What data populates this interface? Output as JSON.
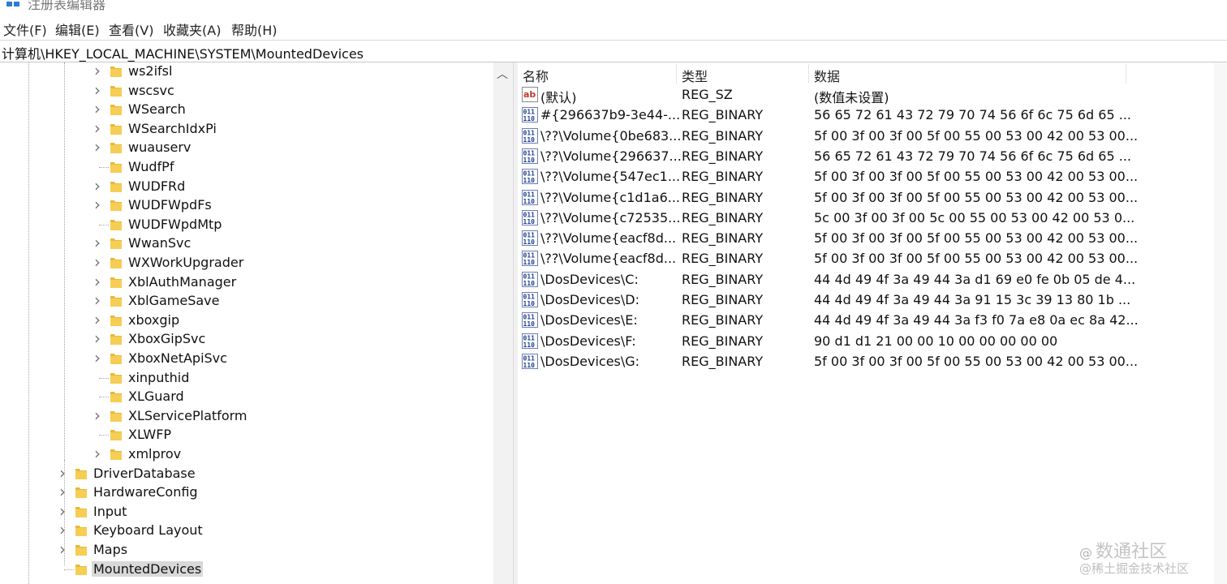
{
  "window": {
    "title": "注册表编辑器"
  },
  "menu": [
    "文件(F)",
    "编辑(E)",
    "查看(V)",
    "收藏夹(A)",
    "帮助(H)"
  ],
  "address": "计算机\\HKEY_LOCAL_MACHINE\\SYSTEM\\MountedDevices",
  "tree": [
    {
      "label": "ws2ifsl",
      "expandable": true
    },
    {
      "label": "wscsvc",
      "expandable": true
    },
    {
      "label": "WSearch",
      "expandable": true
    },
    {
      "label": "WSearchIdxPi",
      "expandable": true
    },
    {
      "label": "wuauserv",
      "expandable": true
    },
    {
      "label": "WudfPf",
      "expandable": false
    },
    {
      "label": "WUDFRd",
      "expandable": true
    },
    {
      "label": "WUDFWpdFs",
      "expandable": true
    },
    {
      "label": "WUDFWpdMtp",
      "expandable": false
    },
    {
      "label": "WwanSvc",
      "expandable": true
    },
    {
      "label": "WXWorkUpgrader",
      "expandable": true
    },
    {
      "label": "XblAuthManager",
      "expandable": true
    },
    {
      "label": "XblGameSave",
      "expandable": true
    },
    {
      "label": "xboxgip",
      "expandable": true
    },
    {
      "label": "XboxGipSvc",
      "expandable": true
    },
    {
      "label": "XboxNetApiSvc",
      "expandable": true
    },
    {
      "label": "xinputhid",
      "expandable": false
    },
    {
      "label": "XLGuard",
      "expandable": false
    },
    {
      "label": "XLServicePlatform",
      "expandable": true
    },
    {
      "label": "XLWFP",
      "expandable": false
    },
    {
      "label": "xmlprov",
      "expandable": true
    },
    {
      "label": "DriverDatabase",
      "expandable": true
    },
    {
      "label": "HardwareConfig",
      "expandable": true
    },
    {
      "label": "Input",
      "expandable": true
    },
    {
      "label": "Keyboard Layout",
      "expandable": true
    },
    {
      "label": "Maps",
      "expandable": true
    },
    {
      "label": "MountedDevices",
      "expandable": false,
      "selected": true
    }
  ],
  "columns": {
    "name": "名称",
    "type": "类型",
    "data": "数据"
  },
  "values": [
    {
      "icon": "string-value-icon",
      "name": "(默认)",
      "type": "REG_SZ",
      "data": "(数值未设置)"
    },
    {
      "icon": "binary-value-icon",
      "name": "#{296637b9-3e44-...",
      "type": "REG_BINARY",
      "data": "56 65 72 61 43 72 79 70 74 56 6f 6c 75 6d 65 ..."
    },
    {
      "icon": "binary-value-icon",
      "name": "\\??\\Volume{0be683...",
      "type": "REG_BINARY",
      "data": "5f 00 3f 00 3f 00 5f 00 55 00 53 00 42 00 53 00..."
    },
    {
      "icon": "binary-value-icon",
      "name": "\\??\\Volume{296637...",
      "type": "REG_BINARY",
      "data": "56 65 72 61 43 72 79 70 74 56 6f 6c 75 6d 65 ..."
    },
    {
      "icon": "binary-value-icon",
      "name": "\\??\\Volume{547ec1...",
      "type": "REG_BINARY",
      "data": "5f 00 3f 00 3f 00 5f 00 55 00 53 00 42 00 53 00..."
    },
    {
      "icon": "binary-value-icon",
      "name": "\\??\\Volume{c1d1a6...",
      "type": "REG_BINARY",
      "data": "5f 00 3f 00 3f 00 5f 00 55 00 53 00 42 00 53 00..."
    },
    {
      "icon": "binary-value-icon",
      "name": "\\??\\Volume{c72535...",
      "type": "REG_BINARY",
      "data": "5c 00 3f 00 3f 00 5c 00 55 00 53 00 42 00 53 0..."
    },
    {
      "icon": "binary-value-icon",
      "name": "\\??\\Volume{eacf8d...",
      "type": "REG_BINARY",
      "data": "5f 00 3f 00 3f 00 5f 00 55 00 53 00 42 00 53 00..."
    },
    {
      "icon": "binary-value-icon",
      "name": "\\??\\Volume{eacf8d...",
      "type": "REG_BINARY",
      "data": "5f 00 3f 00 3f 00 5f 00 55 00 53 00 42 00 53 00..."
    },
    {
      "icon": "binary-value-icon",
      "name": "\\DosDevices\\C:",
      "type": "REG_BINARY",
      "data": "44 4d 49 4f 3a 49 44 3a d1 69 e0 fe 0b 05 de 4..."
    },
    {
      "icon": "binary-value-icon",
      "name": "\\DosDevices\\D:",
      "type": "REG_BINARY",
      "data": "44 4d 49 4f 3a 49 44 3a 91 15 3c 39 13 80 1b ..."
    },
    {
      "icon": "binary-value-icon",
      "name": "\\DosDevices\\E:",
      "type": "REG_BINARY",
      "data": "44 4d 49 4f 3a 49 44 3a f3 f0 7a e8 0a ec 8a 42..."
    },
    {
      "icon": "binary-value-icon",
      "name": "\\DosDevices\\F:",
      "type": "REG_BINARY",
      "data": "90 d1 d1 21 00 00 10 00 00 00 00 00"
    },
    {
      "icon": "binary-value-icon",
      "name": "\\DosDevices\\G:",
      "type": "REG_BINARY",
      "data": "5f 00 3f 00 3f 00 5f 00 55 00 53 00 42 00 53 00..."
    }
  ],
  "watermark": {
    "line1": "@",
    "line1_big": "数通社区",
    "line2": "@稀土掘金技术社区"
  }
}
